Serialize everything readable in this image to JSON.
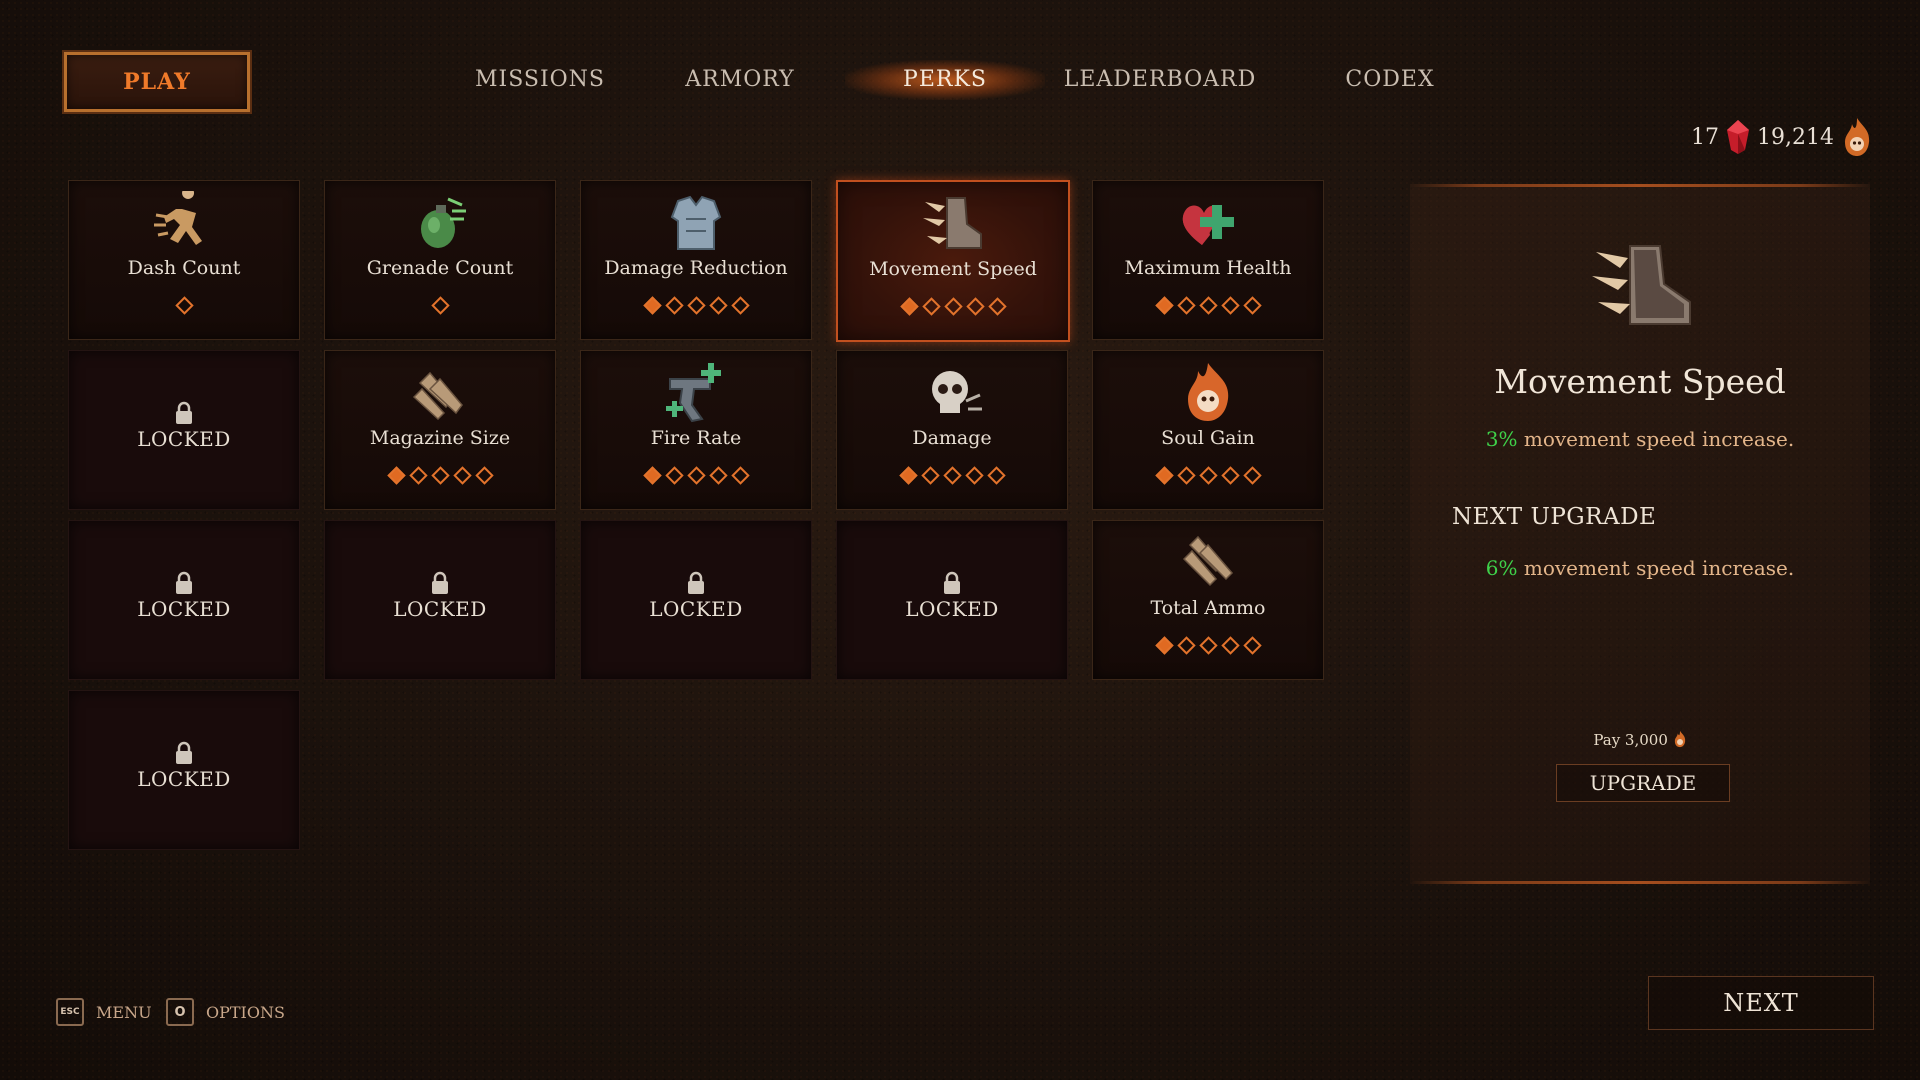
{
  "play_label": "PLAY",
  "tabs": [
    {
      "label": "MISSIONS",
      "active": false
    },
    {
      "label": "ARMORY",
      "active": false
    },
    {
      "label": "PERKS",
      "active": true
    },
    {
      "label": "LEADERBOARD",
      "active": false
    },
    {
      "label": "CODEX",
      "active": false
    }
  ],
  "currency": {
    "gems": "17",
    "souls": "19,214"
  },
  "perks": [
    {
      "name": "Dash Count",
      "icon": "running-figure-icon",
      "level": 0,
      "max": 1,
      "locked": false,
      "selected": false
    },
    {
      "name": "Grenade Count",
      "icon": "grenade-icon",
      "level": 0,
      "max": 1,
      "locked": false,
      "selected": false
    },
    {
      "name": "Damage Reduction",
      "icon": "armor-vest-icon",
      "level": 1,
      "max": 5,
      "locked": false,
      "selected": false
    },
    {
      "name": "Movement Speed",
      "icon": "boot-icon",
      "level": 1,
      "max": 5,
      "locked": false,
      "selected": true
    },
    {
      "name": "Maximum Health",
      "icon": "heart-plus-icon",
      "level": 1,
      "max": 5,
      "locked": false,
      "selected": false
    },
    {
      "name": "LOCKED",
      "locked": true
    },
    {
      "name": "Magazine Size",
      "icon": "bullets-icon",
      "level": 1,
      "max": 5,
      "locked": false,
      "selected": false
    },
    {
      "name": "Fire Rate",
      "icon": "pistol-plus-icon",
      "level": 1,
      "max": 5,
      "locked": false,
      "selected": false
    },
    {
      "name": "Damage",
      "icon": "skull-icon",
      "level": 1,
      "max": 5,
      "locked": false,
      "selected": false
    },
    {
      "name": "Soul Gain",
      "icon": "flaming-skull-icon",
      "level": 1,
      "max": 5,
      "locked": false,
      "selected": false
    },
    {
      "name": "LOCKED",
      "locked": true
    },
    {
      "name": "LOCKED",
      "locked": true
    },
    {
      "name": "LOCKED",
      "locked": true
    },
    {
      "name": "LOCKED",
      "locked": true
    },
    {
      "name": "Total Ammo",
      "icon": "ammo-stack-icon",
      "level": 1,
      "max": 5,
      "locked": false,
      "selected": false
    },
    {
      "name": "LOCKED",
      "locked": true
    }
  ],
  "detail": {
    "title": "Movement Speed",
    "current_pct": "3%",
    "current_text": " movement speed increase.",
    "next_heading": "NEXT UPGRADE",
    "next_pct": "6%",
    "next_text": " movement speed increase.",
    "pay_text": "Pay 3,000",
    "upgrade_label": "UPGRADE"
  },
  "hints": {
    "menu_key": "ESC",
    "menu_label": "MENU",
    "options_key": "O",
    "options_label": "OPTIONS"
  },
  "next_label": "NEXT",
  "colors": {
    "accent": "#e06a22",
    "positive": "#3fd14a",
    "desc": "#e3b58a"
  }
}
